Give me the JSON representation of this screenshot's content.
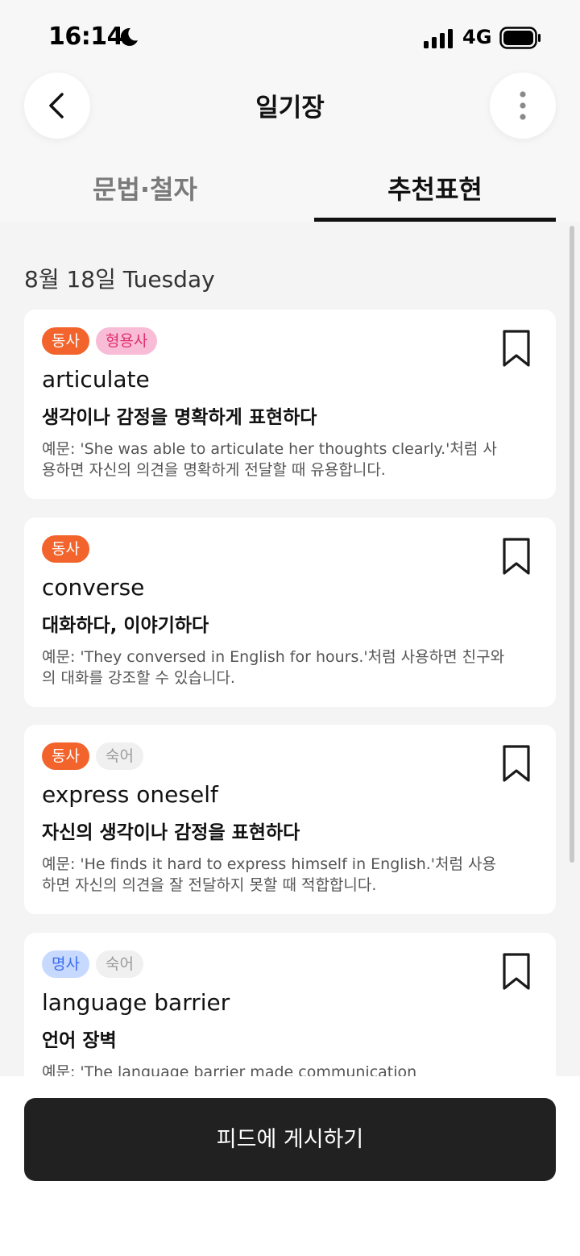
{
  "status_bar": {
    "time": "16:14",
    "network": "4G"
  },
  "header": {
    "title": "일기장"
  },
  "tabs": [
    {
      "label": "문법·철자",
      "active": false
    },
    {
      "label": "추천표현",
      "active": true
    }
  ],
  "date_label": "8월 18일 Tuesday",
  "cards": [
    {
      "tags": [
        {
          "label": "동사"
        },
        {
          "label": "형용사"
        }
      ],
      "word": "articulate",
      "meaning": "생각이나 감정을 명확하게 표현하다",
      "example": "예문: 'She was able to articulate her thoughts clearly.'처럼 사용하면 자신의 의견을 명확하게 전달할 때 유용합니다."
    },
    {
      "tags": [
        {
          "label": "동사"
        }
      ],
      "word": "converse",
      "meaning": "대화하다, 이야기하다",
      "example": "예문: 'They conversed in English for hours.'처럼 사용하면 친구와의 대화를 강조할 수 있습니다."
    },
    {
      "tags": [
        {
          "label": "동사"
        },
        {
          "label": "숙어"
        }
      ],
      "word": "express oneself",
      "meaning": "자신의 생각이나 감정을 표현하다",
      "example": "예문: 'He finds it hard to express himself in English.'처럼 사용하면 자신의 의견을 잘 전달하지 못할 때 적합합니다."
    },
    {
      "tags": [
        {
          "label": "명사"
        },
        {
          "label": "숙어"
        }
      ],
      "word": "language barrier",
      "meaning": "언어 장벽",
      "example": "예문: 'The language barrier made communication"
    }
  ],
  "post_button": {
    "label": "피드에 게시하기"
  },
  "colors": {
    "verb": "#f2642b",
    "adjective": "#f8bcd6",
    "noun": "#c7d9ff",
    "idiom": "#f0f0f0",
    "button": "#212121"
  }
}
